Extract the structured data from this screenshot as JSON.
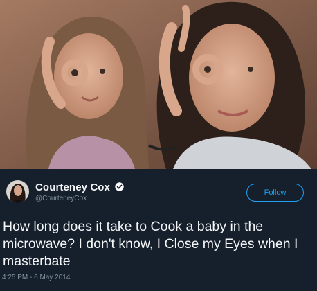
{
  "tweet": {
    "display_name": "Courteney Cox",
    "handle": "@CourteneyCox",
    "follow_label": "Follow",
    "text": "How long does it take to Cook a baby in the microwave? I don't know, I Close my Eyes when I masterbate",
    "timestamp": "4:25 PM - 6 May 2014"
  },
  "icons": {
    "verified": "verified-badge-icon"
  },
  "colors": {
    "background": "#16202c",
    "accent": "#1da1f2",
    "muted_text": "#8394a3"
  }
}
